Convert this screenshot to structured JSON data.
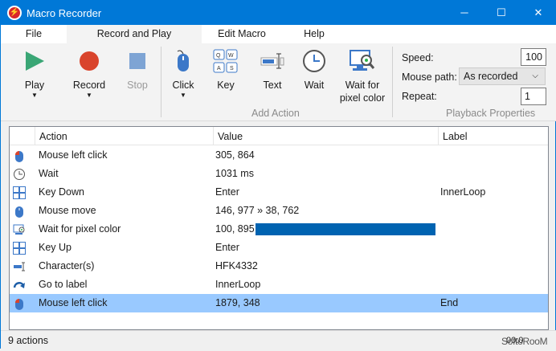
{
  "window": {
    "title": "Macro Recorder",
    "minimize": "─",
    "maximize": "☐",
    "close": "✕"
  },
  "menu": {
    "tabs": [
      "File",
      "Record and Play",
      "Edit Macro",
      "Help"
    ],
    "active": "Record and Play"
  },
  "ribbon": {
    "play": "Play",
    "record": "Record",
    "stop": "Stop",
    "click": "Click",
    "key": "Key",
    "text": "Text",
    "wait": "Wait",
    "wait_pixel": [
      "Wait for",
      "pixel color"
    ],
    "add_action_group": "Add Action",
    "speed_label": "Speed:",
    "speed": "100",
    "mouse_path_label": "Mouse path:",
    "mouse_path": "As recorded",
    "repeat_label": "Repeat:",
    "repeat": "1",
    "playback_group": "Playback Properties"
  },
  "table": {
    "columns": [
      "Action",
      "Value",
      "Label"
    ],
    "rows": [
      {
        "icon": "mouse-click-icon",
        "action": "Mouse left click",
        "value": "305, 864",
        "label": ""
      },
      {
        "icon": "clock-icon",
        "action": "Wait",
        "value": "1031 ms",
        "label": ""
      },
      {
        "icon": "keyboard-icon",
        "action": "Key Down",
        "value": "Enter",
        "label": "InnerLoop"
      },
      {
        "icon": "mouse-icon",
        "action": "Mouse move",
        "value": "146, 977 » 38, 762",
        "label": ""
      },
      {
        "icon": "pixel-color-icon",
        "action": "Wait for pixel color",
        "value": "100, 895",
        "label": "",
        "swatch": "#0063b1"
      },
      {
        "icon": "keyboard-icon",
        "action": "Key Up",
        "value": "Enter",
        "label": ""
      },
      {
        "icon": "text-icon",
        "action": "Character(s)",
        "value": "HFK4332",
        "label": ""
      },
      {
        "icon": "goto-arrow-icon",
        "action": "Go to label",
        "value": "InnerLoop",
        "label": ""
      },
      {
        "icon": "mouse-click-icon",
        "action": "Mouse left click",
        "value": "1879, 348",
        "label": "End",
        "selected": true
      }
    ]
  },
  "status": {
    "count": "9 actions",
    "time": "00:0",
    "watermark": "SoftoRooM"
  },
  "colors": {
    "titlebar": "#0078d7",
    "selection": "#99c9ff",
    "play": "#3aa675",
    "record": "#d9442c",
    "stop": "#7ea4d4"
  }
}
